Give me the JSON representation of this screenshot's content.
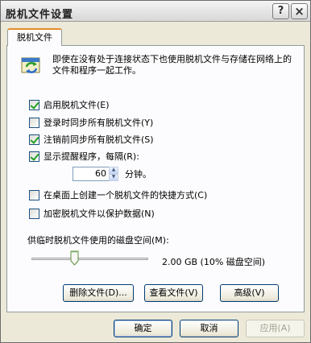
{
  "window": {
    "title": "脱机文件设置",
    "help_glyph": "?",
    "close_glyph": "×"
  },
  "tabs": [
    {
      "label": "脱机文件"
    }
  ],
  "info": {
    "text": "即使在没有处于连接状态下也使用脱机文件与存储在网络上的文件和程序一起工作。",
    "icon": "offline-files-icon"
  },
  "options": [
    {
      "label": "启用脱机文件(E)",
      "checked": true
    },
    {
      "label": "登录时同步所有脱机文件(Y)",
      "checked": false
    },
    {
      "label": "注销前同步所有脱机文件(S)",
      "checked": true
    },
    {
      "label": "显示提醒程序，每隔(R):",
      "checked": true
    }
  ],
  "reminder": {
    "value": "60",
    "unit": "分钟。"
  },
  "options2": [
    {
      "label": "在桌面上创建一个脱机文件的快捷方式(C)",
      "checked": false
    },
    {
      "label": "加密脱机文件以保护数据(N)",
      "checked": false
    }
  ],
  "disk": {
    "label": "供临时脱机文件使用的磁盘空间(M):",
    "value": "2.00 GB  (10% 磁盘空间)",
    "fraction": 0.1
  },
  "panel_buttons": {
    "delete": "删除文件(D)...",
    "view": "查看文件(V)",
    "advanced": "高级(V)"
  },
  "dialog_buttons": {
    "ok": "确定",
    "cancel": "取消",
    "apply": "应用(A)"
  },
  "colors": {
    "tab_accent": "#e68b2c",
    "check": "#21a121",
    "button_border": "#003c74"
  }
}
